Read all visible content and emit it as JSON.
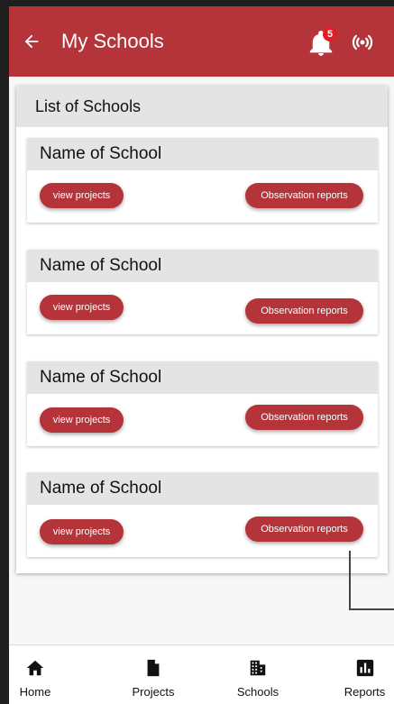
{
  "header": {
    "title": "My Schools",
    "notification_count": "5"
  },
  "panel": {
    "title": "List of Schools"
  },
  "schools": [
    {
      "name": "Name of School",
      "view_label": "view projects",
      "report_label": "Observation reports"
    },
    {
      "name": "Name of School",
      "view_label": "view projects",
      "report_label": "Observation reports"
    },
    {
      "name": "Name of School",
      "view_label": "view projects",
      "report_label": "Observation reports"
    },
    {
      "name": "Name of School",
      "view_label": "view projects",
      "report_label": "Observation reports"
    }
  ],
  "bottom_nav": [
    {
      "label": "Home",
      "icon": "home-icon"
    },
    {
      "label": "Projects",
      "icon": "file-icon"
    },
    {
      "label": "Schools",
      "icon": "building-icon"
    },
    {
      "label": "Reports",
      "icon": "bar-chart-icon"
    }
  ],
  "colors": {
    "primary": "#b4343a",
    "badge": "#e31b23"
  }
}
